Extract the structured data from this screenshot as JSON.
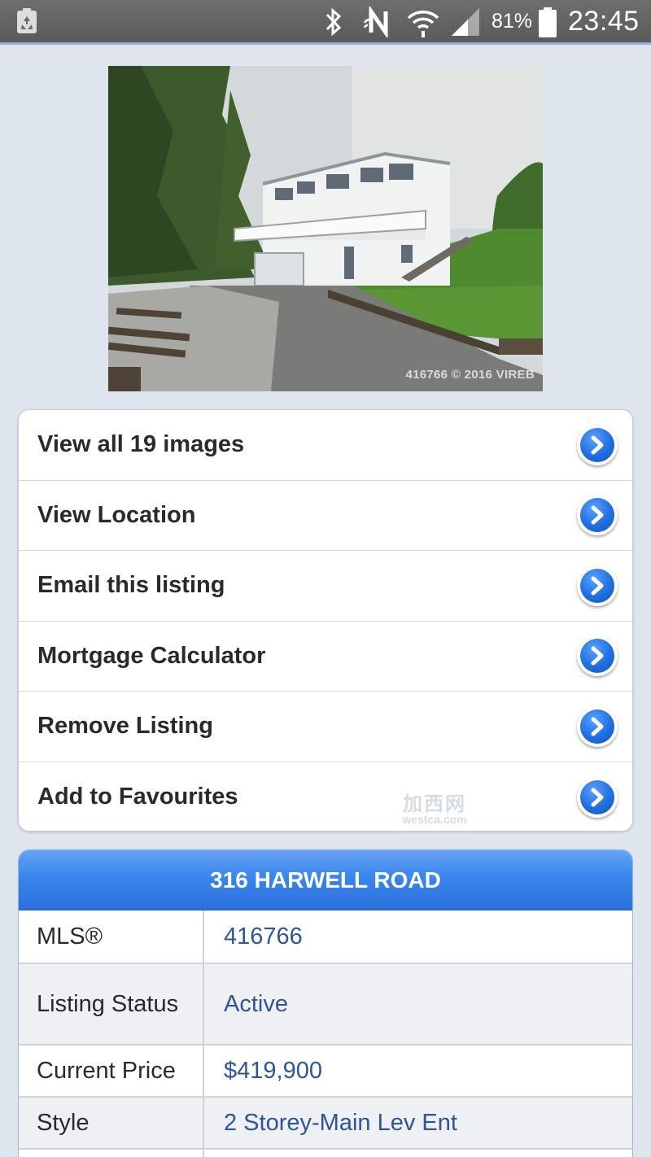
{
  "status_bar": {
    "battery_percent": "81%",
    "time": "23:45",
    "icons": [
      "recycle-icon",
      "bluetooth-icon",
      "nfc-icon",
      "wifi-icon",
      "signal-icon",
      "battery-icon"
    ]
  },
  "photo": {
    "caption": "416766 © 2016 VIREB"
  },
  "actions": [
    {
      "label": "View all 19 images"
    },
    {
      "label": "View Location"
    },
    {
      "label": "Email this listing"
    },
    {
      "label": "Mortgage Calculator"
    },
    {
      "label": "Remove Listing"
    },
    {
      "label": "Add to Favourites"
    }
  ],
  "watermark": {
    "cn": "加西网",
    "en": "westca.com"
  },
  "details": {
    "title": "316 HARWELL ROAD",
    "rows": [
      {
        "key": "MLS®",
        "value": "416766"
      },
      {
        "key": "Listing Status",
        "value": "Active"
      },
      {
        "key": "Current Price",
        "value": "$419,900"
      },
      {
        "key": "Style",
        "value": "2 Storey-Main Lev Ent"
      },
      {
        "key": "",
        "value": ""
      }
    ]
  },
  "colors": {
    "accent": "#2a6fdc",
    "value_text": "#2f5595",
    "background": "#dfe5ef"
  }
}
